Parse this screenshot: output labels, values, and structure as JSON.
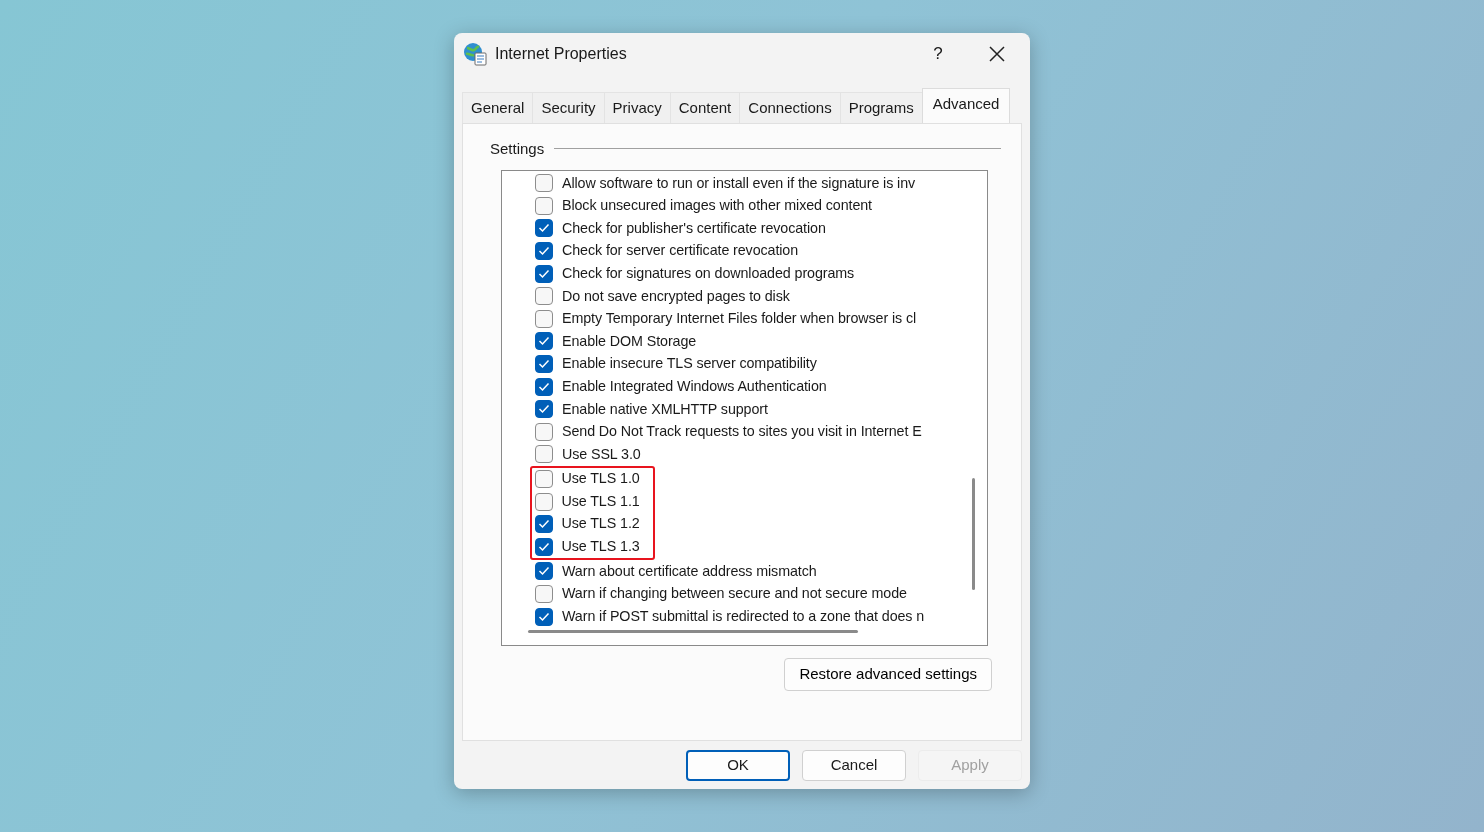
{
  "window": {
    "title": "Internet Properties",
    "help": "?"
  },
  "tabs": [
    {
      "label": "General",
      "selected": false
    },
    {
      "label": "Security",
      "selected": false
    },
    {
      "label": "Privacy",
      "selected": false
    },
    {
      "label": "Content",
      "selected": false
    },
    {
      "label": "Connections",
      "selected": false
    },
    {
      "label": "Programs",
      "selected": false
    },
    {
      "label": "Advanced",
      "selected": true
    }
  ],
  "settings": {
    "legend": "Settings",
    "items": [
      {
        "label": "Allow software to run or install even if the signature is inv",
        "checked": false,
        "highlighted": false
      },
      {
        "label": "Block unsecured images with other mixed content",
        "checked": false,
        "highlighted": false
      },
      {
        "label": "Check for publisher's certificate revocation",
        "checked": true,
        "highlighted": false
      },
      {
        "label": "Check for server certificate revocation",
        "checked": true,
        "highlighted": false
      },
      {
        "label": "Check for signatures on downloaded programs",
        "checked": true,
        "highlighted": false
      },
      {
        "label": "Do not save encrypted pages to disk",
        "checked": false,
        "highlighted": false
      },
      {
        "label": "Empty Temporary Internet Files folder when browser is cl",
        "checked": false,
        "highlighted": false
      },
      {
        "label": "Enable DOM Storage",
        "checked": true,
        "highlighted": false
      },
      {
        "label": "Enable insecure TLS server compatibility",
        "checked": true,
        "highlighted": false
      },
      {
        "label": "Enable Integrated Windows Authentication",
        "checked": true,
        "highlighted": false
      },
      {
        "label": "Enable native XMLHTTP support",
        "checked": true,
        "highlighted": false
      },
      {
        "label": "Send Do Not Track requests to sites you visit in Internet E",
        "checked": false,
        "highlighted": false
      },
      {
        "label": "Use SSL 3.0",
        "checked": false,
        "highlighted": false
      },
      {
        "label": "Use TLS 1.0",
        "checked": false,
        "highlighted": true
      },
      {
        "label": "Use TLS 1.1",
        "checked": false,
        "highlighted": true
      },
      {
        "label": "Use TLS 1.2",
        "checked": true,
        "highlighted": true
      },
      {
        "label": "Use TLS 1.3",
        "checked": true,
        "highlighted": true
      },
      {
        "label": "Warn about certificate address mismatch",
        "checked": true,
        "highlighted": false
      },
      {
        "label": "Warn if changing between secure and not secure mode",
        "checked": false,
        "highlighted": false
      },
      {
        "label": "Warn if POST submittal is redirected to a zone that does n",
        "checked": true,
        "highlighted": false
      }
    ]
  },
  "restore_button": "Restore advanced settings",
  "buttons": [
    {
      "label": "OK",
      "kind": "default",
      "disabled": false
    },
    {
      "label": "Cancel",
      "kind": "normal",
      "disabled": false
    },
    {
      "label": "Apply",
      "kind": "normal",
      "disabled": true
    }
  ]
}
